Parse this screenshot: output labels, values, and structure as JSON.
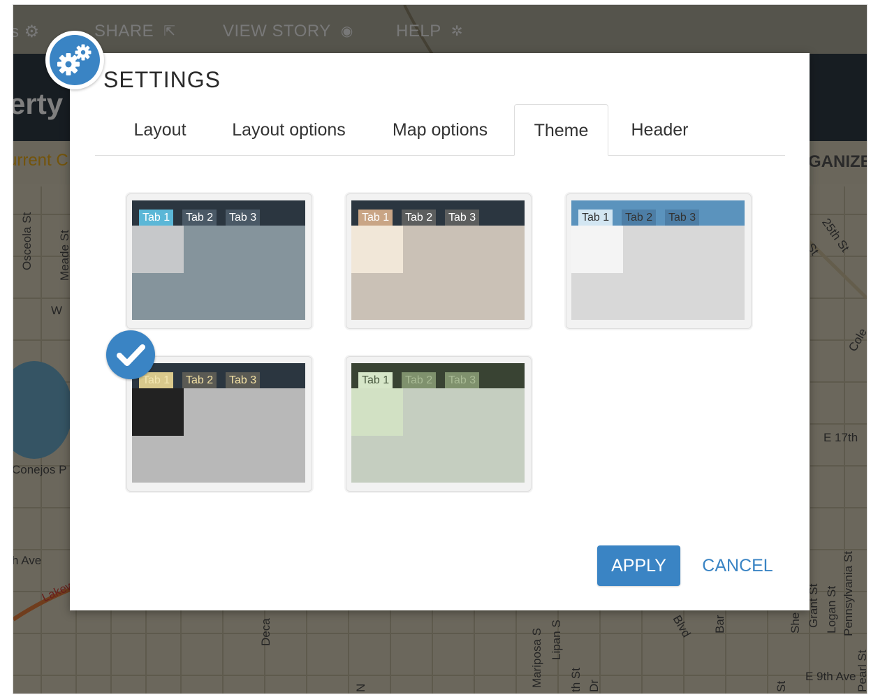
{
  "background": {
    "nav": [
      {
        "label": "SHARE"
      },
      {
        "label": "VIEW STORY"
      },
      {
        "label": "HELP"
      }
    ],
    "app_title": "erty",
    "subtitle": "urrent C",
    "organize": "GANIZE",
    "streets": [
      "Osceola St",
      "Meade St",
      "W",
      "Conejos P",
      "h Ave",
      "Lakew",
      "Deca",
      "Mariposa S",
      "Lipan S",
      "th St",
      "Dr",
      "N",
      "Bar",
      "She",
      "Grant St",
      "Logan St",
      "Pennsylvania St",
      "E 17th",
      "E 9th Ave",
      "Cole",
      "25th St",
      "St",
      "Blvd",
      "Pearl St",
      "St"
    ]
  },
  "dialog": {
    "title": "SETTINGS",
    "tabs": [
      {
        "label": "Layout"
      },
      {
        "label": "Layout options"
      },
      {
        "label": "Map options"
      },
      {
        "label": "Theme"
      },
      {
        "label": "Header"
      }
    ],
    "active_tab": "Theme",
    "themes": [
      {
        "tabs": [
          "Tab 1",
          "Tab 2",
          "Tab 3"
        ],
        "header": "#2b3640",
        "body": "#85949c",
        "panel": "#c6c8ca",
        "active_tab_bg": "#5bb7d7",
        "active_tab_fg": "#ffffff",
        "tab_bg": "#4a5966",
        "tab_fg": "#ffffff",
        "selected": false
      },
      {
        "tabs": [
          "Tab 1",
          "Tab 2",
          "Tab 3"
        ],
        "header": "#2b3640",
        "body": "#cac1b6",
        "panel": "#f1e7d8",
        "active_tab_bg": "#c9a585",
        "active_tab_fg": "#ffffff",
        "tab_bg": "#5c5e5e",
        "tab_fg": "#ffffff",
        "selected": false
      },
      {
        "tabs": [
          "Tab 1",
          "Tab 2",
          "Tab 3"
        ],
        "header": "#5b93bd",
        "body": "#d8d8d8",
        "panel": "#f4f4f4",
        "active_tab_bg": "#d3e6f2",
        "active_tab_fg": "#333333",
        "tab_bg": "#4d7ea6",
        "tab_fg": "#333333",
        "selected": false
      },
      {
        "tabs": [
          "Tab 1",
          "Tab 2",
          "Tab 3"
        ],
        "header": "#2b3640",
        "body": "#b8b8b8",
        "panel": "#222222",
        "active_tab_bg": "#d9c98c",
        "active_tab_fg": "#f3e6b0",
        "tab_bg": "#5a5a54",
        "tab_fg": "#f3e1a4",
        "selected": true
      },
      {
        "tabs": [
          "Tab 1",
          "Tab 2",
          "Tab 3"
        ],
        "header": "#394333",
        "body": "#c5cec0",
        "panel": "#d2e1c4",
        "active_tab_bg": "#d6e6c8",
        "active_tab_fg": "#4a5a40",
        "tab_bg": "#7f916d",
        "tab_fg": "#a9bb95",
        "selected": false
      }
    ],
    "apply_label": "APPLY",
    "cancel_label": "CANCEL"
  },
  "colors": {
    "accent": "#3a84c4"
  }
}
